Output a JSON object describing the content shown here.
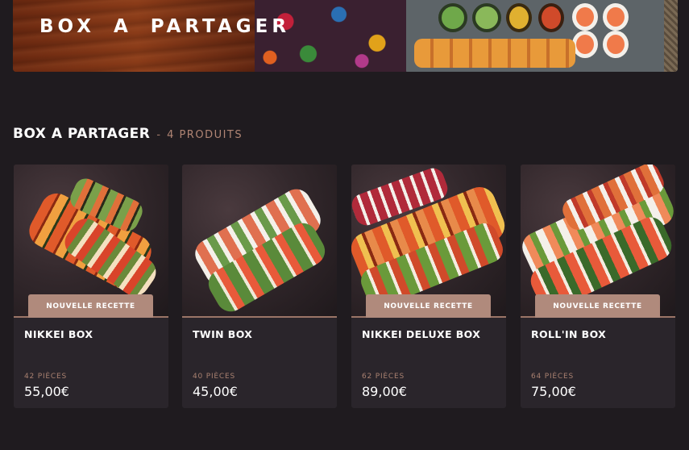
{
  "banner": {
    "title": "BOX A PARTAGER"
  },
  "section": {
    "title": "BOX A PARTAGER",
    "separator": "-",
    "count": "4 PRODUITS"
  },
  "products": [
    {
      "badge": "NOUVELLE RECETTE",
      "name": "NIKKEI BOX",
      "pieces": "42 PIÈCES",
      "price": "55,00€"
    },
    {
      "badge": "NOUVELLE RECETTE",
      "name": "TWIN BOX",
      "pieces": "40 PIÈCES",
      "price": "45,00€"
    },
    {
      "badge": "NOUVELLE RECETTE",
      "name": "NIKKEI DELUXE BOX",
      "pieces": "62 PIÈCES",
      "price": "89,00€"
    },
    {
      "badge": "NOUVELLE RECETTE",
      "name": "ROLL'IN BOX",
      "pieces": "64 PIÈCES",
      "price": "75,00€"
    }
  ],
  "colors": {
    "background": "#1f1b1f",
    "card": "#2a252b",
    "accent": "#b08a7c"
  }
}
